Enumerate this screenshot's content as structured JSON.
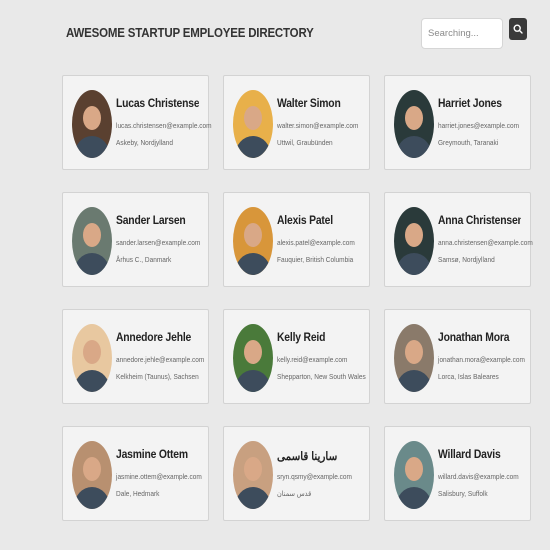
{
  "header": {
    "title": "AWESOME STARTUP EMPLOYEE DIRECTORY",
    "search_placeholder": "Searching...",
    "search_icon": "search-icon"
  },
  "employees": [
    {
      "name": "Lucas Christensen",
      "email": "lucas.christensen@example.com",
      "location": "Askeby, Nordjylland",
      "avatar_color": "#5a4030"
    },
    {
      "name": "Walter Simon",
      "email": "walter.simon@example.com",
      "location": "Uttwil, Graubünden",
      "avatar_color": "#e8b04a"
    },
    {
      "name": "Harriet Jones",
      "email": "harriet.jones@example.com",
      "location": "Greymouth, Taranaki",
      "avatar_color": "#2a3a3a"
    },
    {
      "name": "Sander Larsen",
      "email": "sander.larsen@example.com",
      "location": "Århus C., Danmark",
      "avatar_color": "#6a7a70"
    },
    {
      "name": "Alexis Patel",
      "email": "alexis.patel@example.com",
      "location": "Fauquier, British Columbia",
      "avatar_color": "#d8963a"
    },
    {
      "name": "Anna Christensen",
      "email": "anna.christensen@example.com",
      "location": "Samsø, Nordjylland",
      "avatar_color": "#2a3a3a"
    },
    {
      "name": "Annedore Jehle",
      "email": "annedore.jehle@example.com",
      "location": "Kelkheim (Taunus), Sachsen",
      "avatar_color": "#e8c8a0"
    },
    {
      "name": "Kelly Reid",
      "email": "kelly.reid@example.com",
      "location": "Shepparton, New South Wales",
      "avatar_color": "#4a7a3a"
    },
    {
      "name": "Jonathan Mora",
      "email": "jonathan.mora@example.com",
      "location": "Lorca, Islas Baleares",
      "avatar_color": "#8a7a6a"
    },
    {
      "name": "Jasmine Ottem",
      "email": "jasmine.ottem@example.com",
      "location": "Dale, Hedmark",
      "avatar_color": "#b89070"
    },
    {
      "name": "سارينا قاسمی",
      "email": "sryn.qsmy@example.com",
      "location": "قدس سمنان",
      "avatar_color": "#c8a080"
    },
    {
      "name": "Willard Davis",
      "email": "willard.davis@example.com",
      "location": "Salisbury, Suffolk",
      "avatar_color": "#6a8a8a"
    }
  ]
}
